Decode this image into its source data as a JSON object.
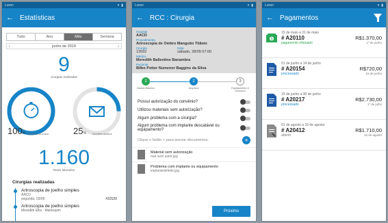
{
  "statusbar": {
    "carrier": "Loren"
  },
  "panel1": {
    "title": "Estatísticas",
    "tabs": [
      "Tudo",
      "Ano",
      "Mês",
      "Semana"
    ],
    "active_tab": "Mês",
    "period": "junho de 2019",
    "cirurgias_value": "9",
    "cirurgias_caption": "cirurgias realizadas",
    "checkins_value": "100",
    "checkins_caption": "checkins no prazo",
    "checkins_fraction": 1.0,
    "convites_value": "25",
    "convites_caption": "convites aceitos",
    "convites_fraction": 0.25,
    "reais_value": "1.160",
    "reais_caption": "Reais faturados",
    "list_title": "Cirurgias realizadas",
    "surgeries": [
      {
        "name": "Artroscopia de joelho simples",
        "place": "AACD",
        "date": "segunda, 03/06",
        "code": "#10120"
      },
      {
        "name": "Artroscopia de joelho simples",
        "place": "Meredith Ellis - Manequim",
        "date": "",
        "code": ""
      }
    ]
  },
  "panel2": {
    "title": "RCC : Cirurgia",
    "info": {
      "hospital_label": "Hospital",
      "hospital": "AACD",
      "procedure_label": "Procedimento",
      "procedure": "Artroscopia de Ombro Manguito Titânio",
      "cirurgia_label": "Cirurgia",
      "cirurgia": "13592",
      "data_label": "Data",
      "data": "sábado, 28/09   07:00",
      "medico_label": "Médico",
      "medico": "Meredith Ballentine Banambra",
      "paciente_label": "Paciente",
      "paciente": "Bilbo Potter Numenor Baggins da Silva"
    },
    "steps": [
      {
        "num": "1",
        "label": "Dados Básicos"
      },
      {
        "num": "2",
        "label": "Arquivos"
      },
      {
        "num": "3",
        "label": "Equipamento e consumo"
      }
    ],
    "questions": [
      "Possui autorização do convênio?",
      "Utilizou materiais sem autorização?",
      "Algum problema com a cirurgia?",
      "Algum problema com implante descatável ou equipamento?"
    ],
    "attach_hint": "Clique o botão + para anexar documentos.",
    "files": [
      {
        "name": "Material sem autorização",
        "file": "mat sem autor.jpg"
      },
      {
        "name": "Problema com implante ou equipamento",
        "file": "implantedefeito.jpg"
      }
    ],
    "next_label": "Próximo"
  },
  "panel3": {
    "title": "Pagamentos",
    "payments": [
      {
        "period": "15 de maio a 31 de maio",
        "number": "# A20110",
        "status": "pagamento efetuado",
        "amount": "R$1.370,00",
        "sub": "1º de junho",
        "icon": "money-icon",
        "status_color": "#2aa956"
      },
      {
        "period": "01 de junho a 14 de junho",
        "number": "# A20154",
        "status": "processado",
        "amount": "R$720,00",
        "sub": "15 de junho",
        "icon": "document-icon",
        "status_color": "#1784c7"
      },
      {
        "period": "15 de junho a 30 de junho",
        "number": "# A20217",
        "status": "processado",
        "amount": "R$2.730,00",
        "sub": "1º de julho",
        "icon": "document-icon",
        "status_color": "#1784c7"
      },
      {
        "period": "01 de agosto a 15 de agosto",
        "number": "# A20412",
        "status": "aberto",
        "amount": "R$1.710,00",
        "sub": "16 de agosto",
        "icon": "open-document-icon",
        "status_color": "#777777"
      }
    ]
  }
}
